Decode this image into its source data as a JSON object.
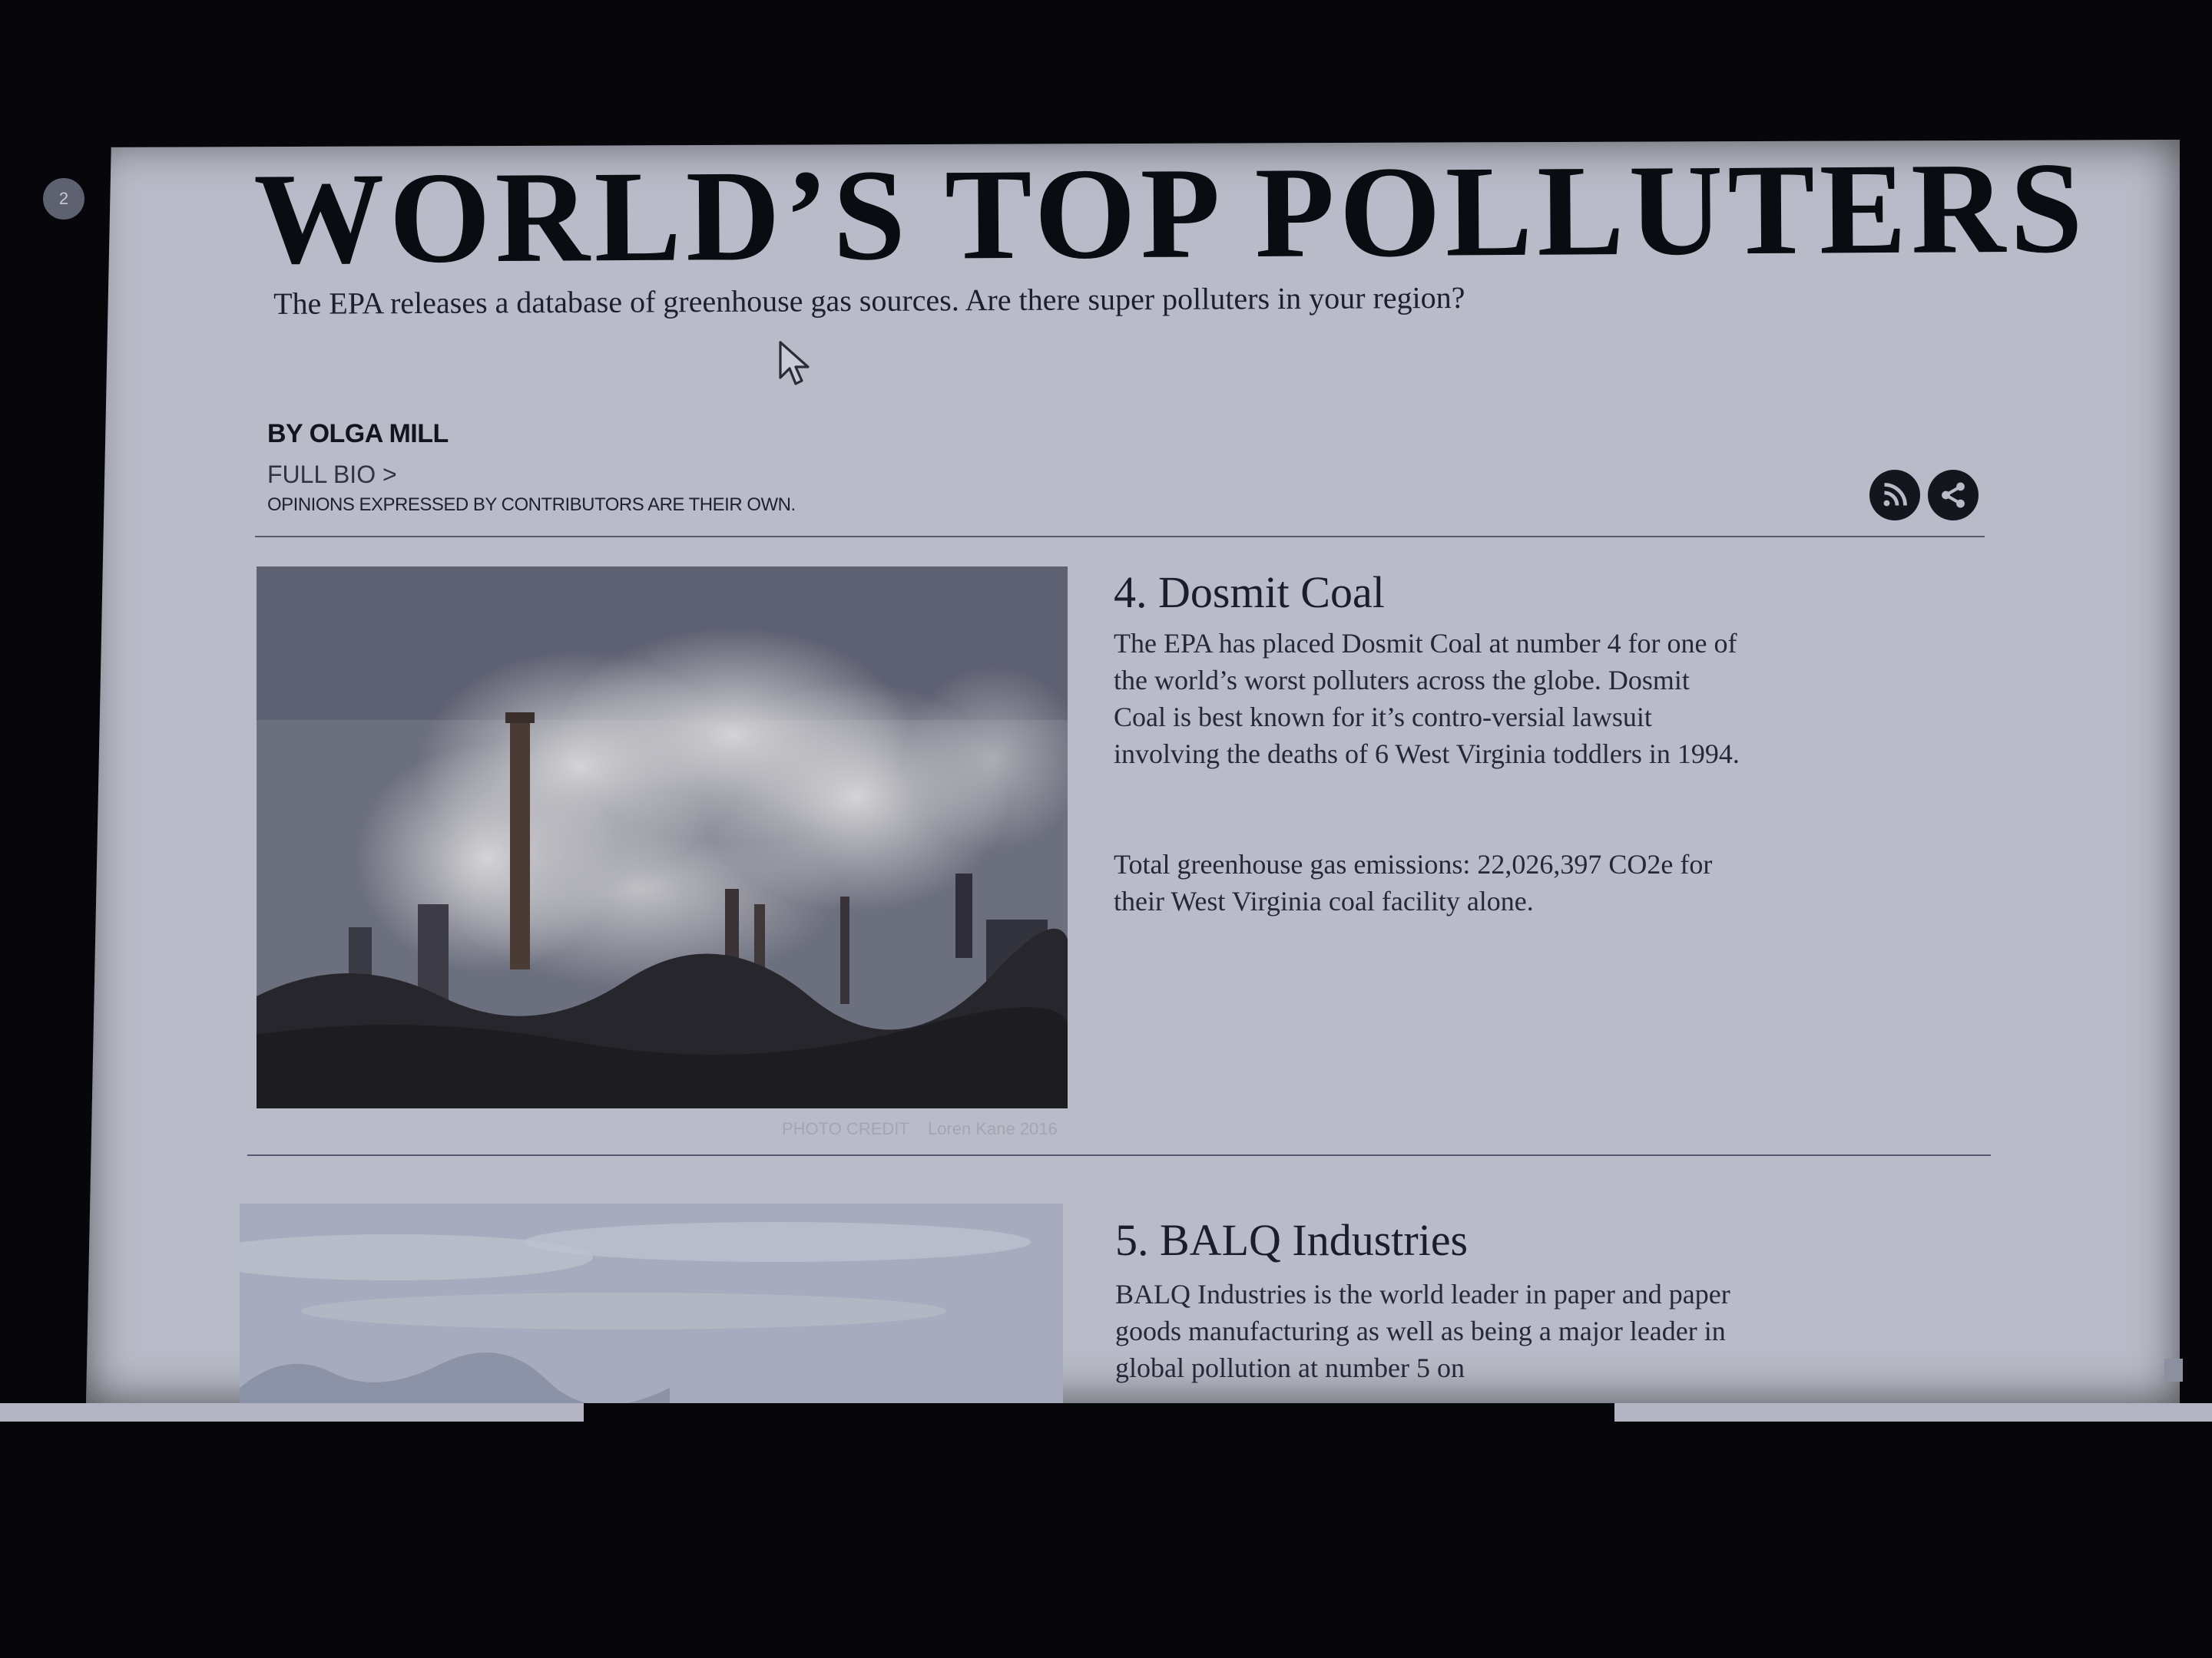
{
  "page_badge": "2",
  "headline": "WORLD’S TOP POLLUTERS",
  "subheadline": "The EPA releases a database of greenhouse gas sources.  Are there super polluters in your region?",
  "author": {
    "byline": "BY OLGA MILL",
    "full_bio": "FULL BIO >",
    "disclaimer": "OPINIONS EXPRESSED BY CONTRIBUTORS ARE THEIR OWN."
  },
  "actions": {
    "rss_icon": "rss-icon",
    "share_icon": "share-icon"
  },
  "articles": [
    {
      "title": "4. Dosmit Coal",
      "body": "The EPA has placed Dosmit Coal at number 4 for one of  the world’s worst polluters across the globe. Dosmit Coal is best known for it’s contro-versial lawsuit involving the deaths of 6 West Virginia toddlers in 1994.",
      "stats": "Total greenhouse gas emissions: 22,026,397 CO2e for their West Virginia coal facility alone.",
      "photo_credit_label": "PHOTO CREDIT",
      "photo_credit_name": "Loren Kane 2016"
    },
    {
      "title": "5. BALQ Industries",
      "body": "BALQ Industries is the world leader in paper and paper goods manufacturing as well as being a major leader in global pollution at number 5 on"
    }
  ],
  "colors": {
    "page_bg": "#b9bcc8",
    "frame": "#06060b",
    "headline": "#0b0c12",
    "icon_button": "#14151d"
  }
}
